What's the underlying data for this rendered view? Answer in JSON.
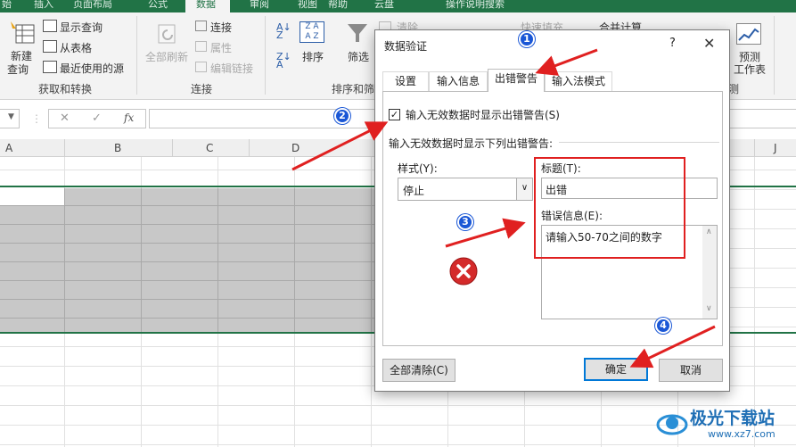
{
  "ribbon": {
    "tabs": [
      "始",
      "插入",
      "页面布局",
      "公式",
      "数据",
      "审阅",
      "视图",
      "帮助",
      "云盘",
      "操作说明搜索"
    ],
    "active_tab": "数据",
    "new_query": [
      "新建",
      "查询"
    ],
    "show_query": "显示查询",
    "from_table": "从表格",
    "recent_sources": "最近使用的源",
    "group_get_transform": "获取和转换",
    "refresh_all": "全部刷新",
    "connections": "连接",
    "properties": "属性",
    "edit_links": "编辑链接",
    "group_connections": "连接",
    "sort": "排序",
    "filter": "筛选",
    "clear": "清除",
    "group_sort_filter": "排序和筛",
    "flash_fill": "快速填充",
    "consolidate": "合并计算",
    "forecast": [
      "预测",
      "工作表"
    ],
    "group_forecast": "测"
  },
  "formula_bar": {
    "cancel": "✕",
    "enter": "✓",
    "fx": "fx"
  },
  "columns": [
    "A",
    "B",
    "C",
    "D",
    "J"
  ],
  "dialog": {
    "title": "数据验证",
    "help": "?",
    "close": "✕",
    "tabs": [
      "设置",
      "输入信息",
      "出错警告",
      "输入法模式"
    ],
    "active_tab": "出错警告",
    "show_error_checkbox_label": "输入无效数据时显示出错警告(S)",
    "show_error_checked": true,
    "section_label": "输入无效数据时显示下列出错警告:",
    "style_label": "样式(Y):",
    "style_value": "停止",
    "title_label": "标题(T):",
    "title_value": "出错",
    "error_msg_label": "错误信息(E):",
    "error_msg_value": "请输入50-70之间的数字",
    "clear_all": "全部清除(C)",
    "ok": "确定",
    "cancel": "取消"
  },
  "annotations": [
    "1",
    "2",
    "3",
    "4"
  ],
  "watermark": {
    "text": "极光下载站",
    "url": "www.xz7.com"
  },
  "colors": {
    "excel_green": "#217346",
    "annotation_red": "#e02020",
    "badge_blue": "#1a57d6"
  }
}
